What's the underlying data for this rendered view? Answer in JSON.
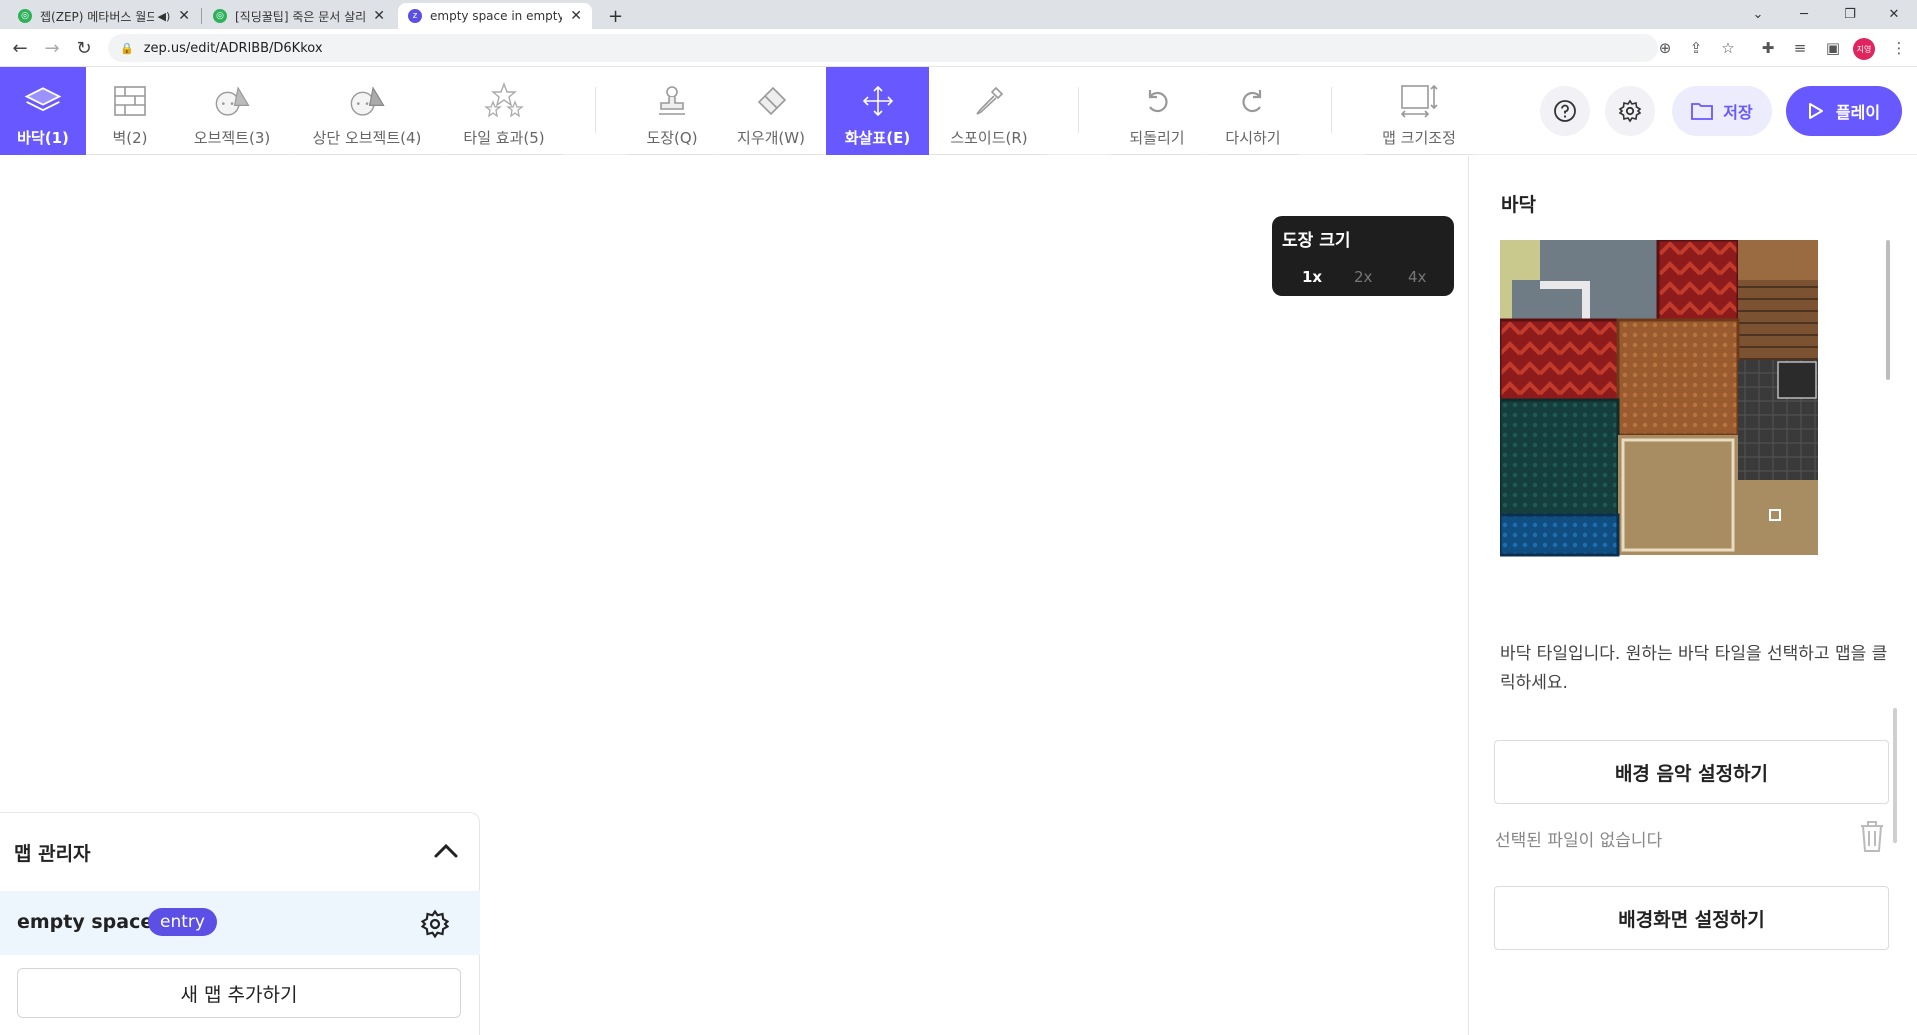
{
  "browser": {
    "tabs": [
      {
        "title": "젭(ZEP) 메타버스 월드 만들",
        "active": false,
        "favicon": "zep-green-icon",
        "muted_icon": "speaker-icon"
      },
      {
        "title": "[직딩꿀팁] 죽은 문서 살리는 인",
        "active": false,
        "favicon": "zep-green-icon"
      },
      {
        "title": "empty space in empty space - Z",
        "active": true,
        "favicon": "zep-purple-icon"
      }
    ],
    "new_tab": "+",
    "url": "zep.us/edit/ADRlBB/D6Kkox",
    "profile_label": "지영"
  },
  "toolbar": {
    "layers": [
      {
        "label": "바닥(1)",
        "icon": "floor-layers-icon",
        "active": true
      },
      {
        "label": "벽(2)",
        "icon": "wall-brick-icon",
        "active": false
      },
      {
        "label": "오브젝트(3)",
        "icon": "object-icon",
        "active": false
      },
      {
        "label": "상단 오브젝트(4)",
        "icon": "top-object-icon",
        "active": false
      },
      {
        "label": "타일 효과(5)",
        "icon": "tile-effect-stars-icon",
        "active": false
      }
    ],
    "tools": [
      {
        "label": "도장(Q)",
        "icon": "stamp-icon",
        "active": false
      },
      {
        "label": "지우개(W)",
        "icon": "eraser-icon",
        "active": false
      },
      {
        "label": "화살표(E)",
        "icon": "move-arrows-icon",
        "active": true
      },
      {
        "label": "스포이드(R)",
        "icon": "eyedropper-icon",
        "active": false
      }
    ],
    "history": [
      {
        "label": "되돌리기",
        "icon": "undo-icon"
      },
      {
        "label": "다시하기",
        "icon": "redo-icon"
      }
    ],
    "resize": {
      "label": "맵 크기조정",
      "icon": "resize-map-icon"
    },
    "save_label": "저장",
    "play_label": "플레이",
    "accent_color": "#6758ff"
  },
  "brush_size": {
    "title": "도장 크기",
    "options": [
      "1x",
      "2x",
      "4x"
    ],
    "selected": "1x"
  },
  "right_panel": {
    "title": "바닥",
    "description": "바닥 타일입니다. 원하는 바닥 타일을 선택하고 맵을 클릭하세요.",
    "bgm_button": "배경 음악 설정하기",
    "no_file_text": "선택된 파일이 없습니다",
    "background_button": "배경화면 설정하기"
  },
  "map_manager": {
    "title": "맵 관리자",
    "maps": [
      {
        "name": "empty space",
        "badge": "entry"
      }
    ],
    "add_button": "새 맵 추가하기"
  }
}
